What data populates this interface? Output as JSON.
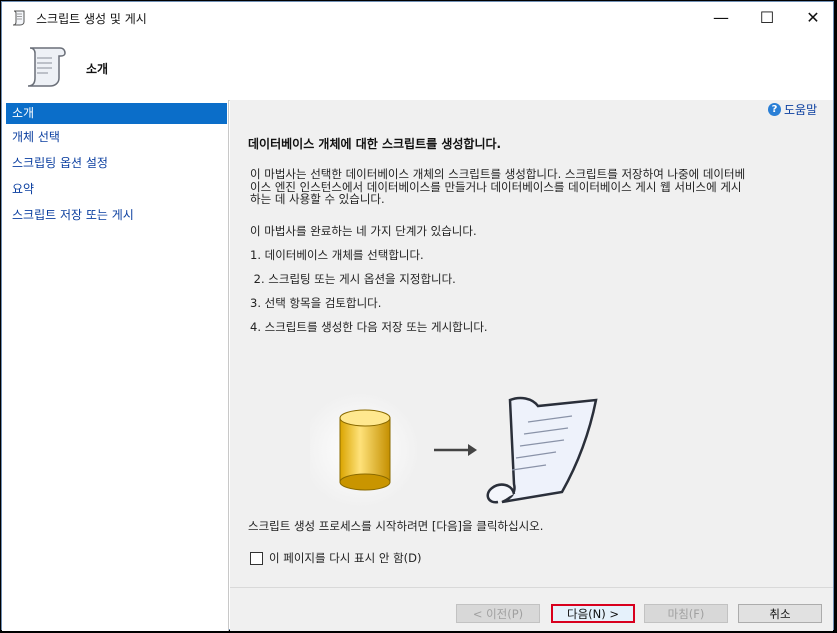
{
  "window": {
    "title": "스크립트 생성 및 게시",
    "minimize_glyph": "—",
    "maximize_glyph": "☐",
    "close_glyph": "✕"
  },
  "header": {
    "title": "소개",
    "icon": "script-scroll-icon"
  },
  "sidebar": {
    "items": [
      {
        "label": "소개",
        "active": true
      },
      {
        "label": "개체 선택",
        "active": false
      },
      {
        "label": "스크립팅 옵션 설정",
        "active": false
      },
      {
        "label": "요약",
        "active": false
      },
      {
        "label": "스크립트 저장 또는 게시",
        "active": false
      }
    ]
  },
  "content": {
    "help_label": "도움말",
    "title": "데이터베이스 개체에 대한 스크립트를 생성합니다.",
    "intro_line1": "이 마법사는 선택한 데이터베이스 개체의 스크립트를 생성합니다. 스크립트를 저장하여 나중에 데이터베",
    "intro_line2": "이스 엔진 인스턴스에서 데이터베이스를 만들거나 데이터베이스를 데이터베이스 게시 웹 서비스에 게시",
    "intro_line3": "하는 데 사용할 수 있습니다.",
    "steps_intro": "이 마법사를 완료하는 네 가지 단계가 있습니다.",
    "steps": [
      "1. 데이터베이스 개체를 선택합니다.",
      " 2. 스크립팅 또는 게시 옵션을 지정합니다.",
      "3. 선택 항목을 검토합니다.",
      "4. 스크립트를 생성한 다음 저장 또는 게시합니다."
    ],
    "start_text": "스크립트 생성 프로세스를 시작하려면 [다음]을 클릭하십시오.",
    "checkbox_label": "이 페이지를 다시 표시 안 함(D)",
    "checkbox_checked": false
  },
  "footer": {
    "prev_label": "< 이전(P)",
    "next_label": "다음(N) >",
    "finish_label": "마침(F)",
    "cancel_label": "취소"
  },
  "colors": {
    "accent": "#0b6ec9",
    "link": "#0b3fa0",
    "default_button_border": "#d8001e"
  }
}
